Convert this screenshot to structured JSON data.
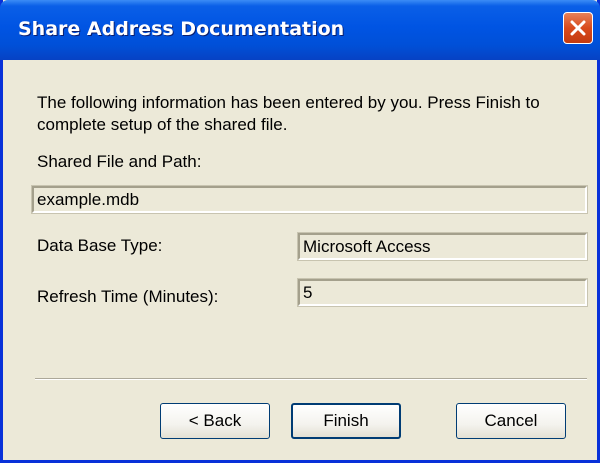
{
  "window": {
    "title": "Share Address Documentation"
  },
  "intro_text": "The following information has been entered by you.  Press Finish to complete setup of the shared file.",
  "fields": {
    "shared_file_label": "Shared File and Path:",
    "shared_file_value": "example.mdb",
    "db_type_label": "Data Base Type:",
    "db_type_value": "Microsoft Access",
    "refresh_label": "Refresh Time (Minutes):",
    "refresh_value": "5"
  },
  "buttons": {
    "back": "< Back",
    "finish": "Finish",
    "cancel": "Cancel"
  },
  "icons": {
    "close": "close-icon"
  },
  "colors": {
    "title_bar": "#0054e3",
    "close_button": "#d94a1c",
    "dialog_background": "#ece9d8"
  }
}
